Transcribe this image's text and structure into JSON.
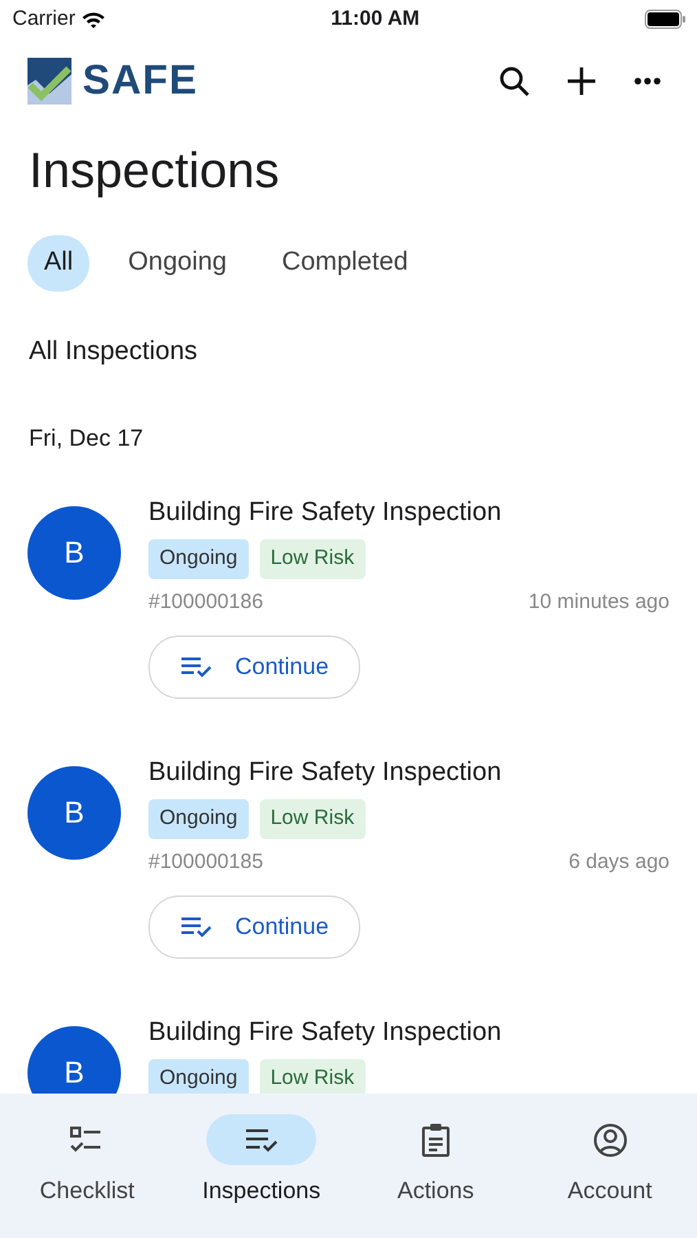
{
  "status_bar": {
    "carrier": "Carrier",
    "time": "11:00 AM"
  },
  "header": {
    "logo_text": "SAFE"
  },
  "title": "Inspections",
  "filters": [
    {
      "label": "All",
      "selected": true
    },
    {
      "label": "Ongoing",
      "selected": false
    },
    {
      "label": "Completed",
      "selected": false
    }
  ],
  "section_title": "All Inspections",
  "date": "Fri, Dec 17",
  "inspections": [
    {
      "avatar": "B",
      "title": "Building Fire Safety Inspection",
      "status": "Ongoing",
      "risk": "Low Risk",
      "number": "#100000186",
      "time": "10 minutes ago",
      "action": "Continue"
    },
    {
      "avatar": "B",
      "title": "Building Fire Safety Inspection",
      "status": "Ongoing",
      "risk": "Low Risk",
      "number": "#100000185",
      "time": "6 days ago",
      "action": "Continue"
    },
    {
      "avatar": "B",
      "title": "Building Fire Safety Inspection",
      "status": "Ongoing",
      "risk": "Low Risk"
    }
  ],
  "bottom_nav": [
    {
      "label": "Checklist",
      "kind": "checklist",
      "selected": false
    },
    {
      "label": "Inspections",
      "kind": "inspections",
      "selected": true
    },
    {
      "label": "Actions",
      "kind": "actions",
      "selected": false
    },
    {
      "label": "Account",
      "kind": "account",
      "selected": false
    }
  ]
}
